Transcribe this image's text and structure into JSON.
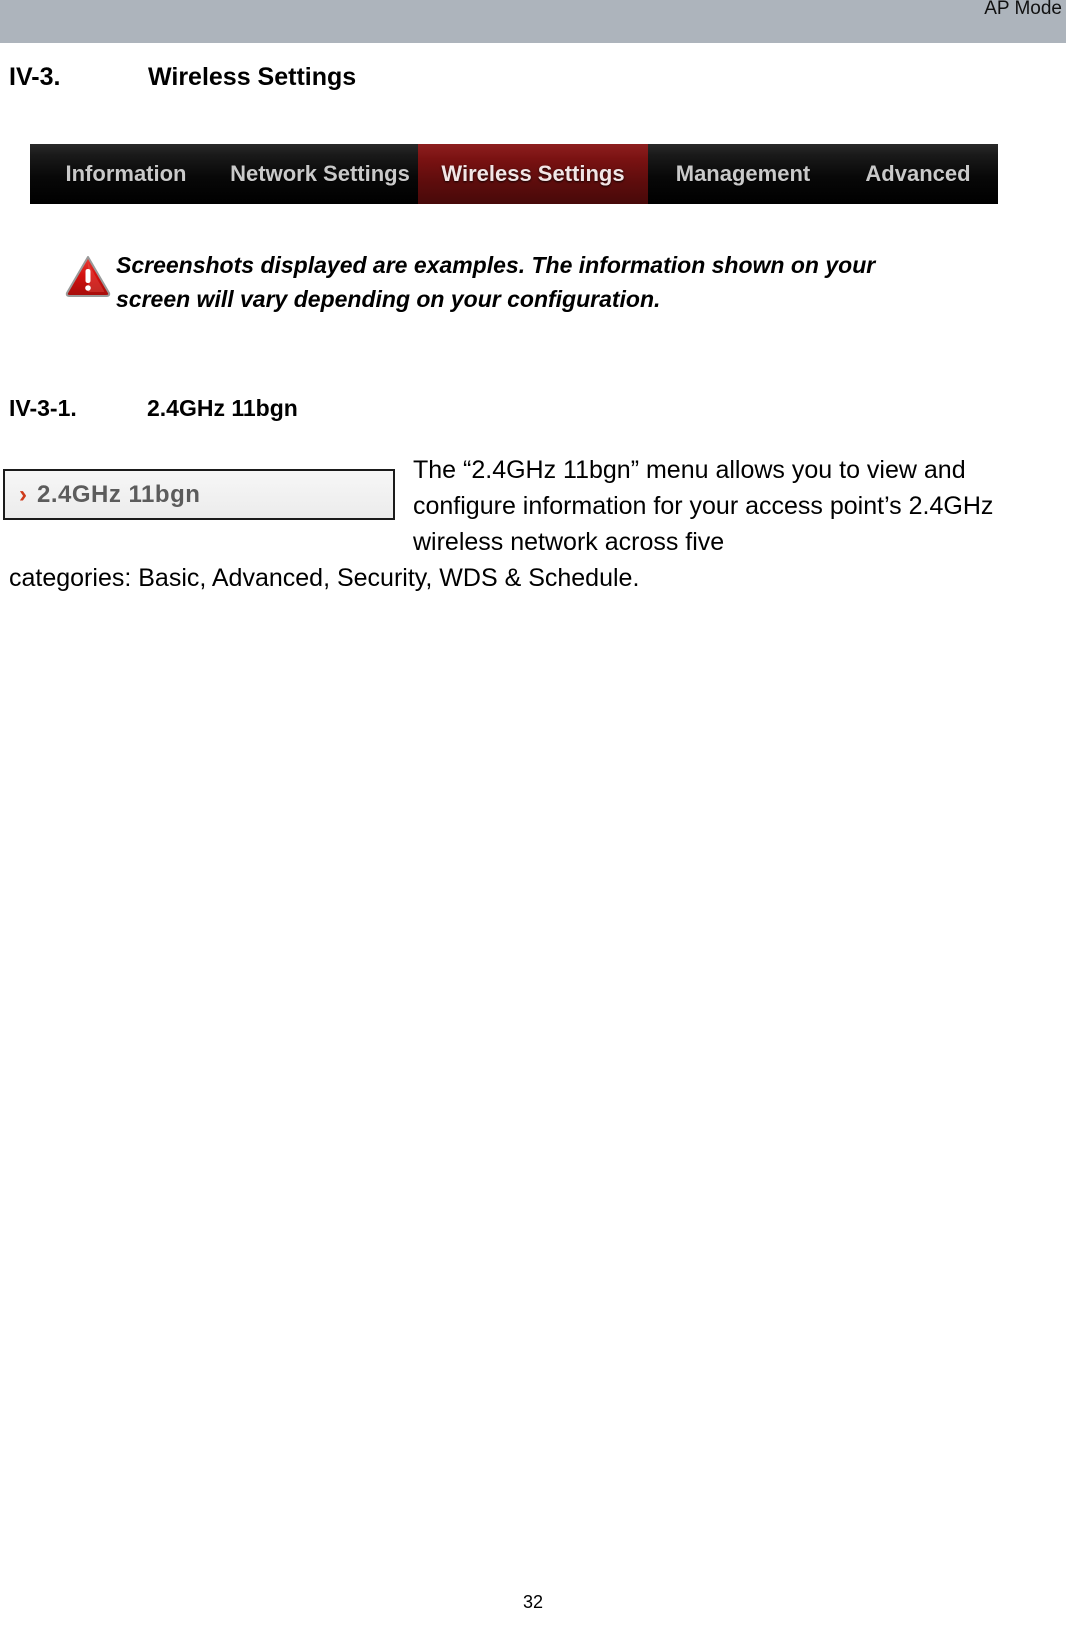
{
  "header": {
    "mode_label": "AP Mode",
    "band_color": "#adb4bc"
  },
  "sections": {
    "main": {
      "number": "IV-3.",
      "title": "Wireless Settings"
    },
    "sub": {
      "number": "IV-3-1.",
      "title": "2.4GHz 11bgn"
    }
  },
  "navbar": {
    "active_tab": "Wireless Settings",
    "active_color": "#7a1212",
    "tabs": [
      {
        "label": "Information",
        "active": false
      },
      {
        "label": "Network Settings",
        "active": false
      },
      {
        "label": "Wireless Settings",
        "active": true
      },
      {
        "label": "Management",
        "active": false
      },
      {
        "label": "Advanced",
        "active": false
      }
    ]
  },
  "warning": {
    "icon": "warning-triangle-icon",
    "icon_color": "#d81b1b",
    "text": "Screenshots displayed are examples. The information shown on your screen will vary depending on your configuration."
  },
  "menu_button": {
    "chevron": "›",
    "chevron_color": "#cf3b1b",
    "label": "2.4GHz 11bgn"
  },
  "body": {
    "paragraph_right": "The “2.4GHz 11bgn” menu allows you to view and configure information for your access point’s 2.4GHz wireless network across five",
    "paragraph_full": "categories: Basic, Advanced, Security, WDS & Schedule."
  },
  "footer": {
    "page_number": "32"
  }
}
